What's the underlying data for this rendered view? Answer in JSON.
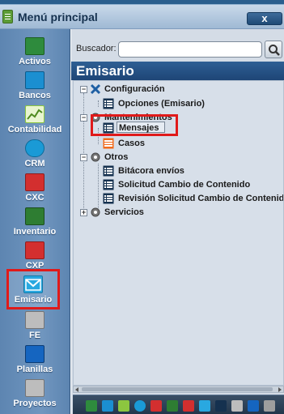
{
  "window": {
    "title": "Menú principal",
    "close_label": "x"
  },
  "sidebar": {
    "items": [
      {
        "label": "Activos",
        "icon": "ledger-icon",
        "color": "#2e8b3d"
      },
      {
        "label": "Bancos",
        "icon": "briefcase-icon",
        "color": "#1b8fd1"
      },
      {
        "label": "Contabilidad",
        "icon": "chart-icon",
        "color": "#8cc63f"
      },
      {
        "label": "CRM",
        "icon": "globe-icon",
        "color": "#1a9ad6"
      },
      {
        "label": "CXC",
        "icon": "money-icon",
        "color": "#d32f2f"
      },
      {
        "label": "Inventario",
        "icon": "worker-icon",
        "color": "#2e7d32"
      },
      {
        "label": "CXP",
        "icon": "money-out-icon",
        "color": "#d32f2f"
      },
      {
        "label": "Emisario",
        "icon": "envelope-icon",
        "color": "#29a8e0"
      },
      {
        "label": "FE",
        "icon": "tools-icon",
        "color": "#9e9e9e"
      },
      {
        "label": "Planillas",
        "icon": "stack-icon",
        "color": "#1565c0"
      },
      {
        "label": "Proyectos",
        "icon": "pencil-ruler-icon",
        "color": "#9e9e9e"
      }
    ]
  },
  "search": {
    "label": "Buscador:",
    "value": "",
    "placeholder": ""
  },
  "section": {
    "title": "Emisario"
  },
  "tree": {
    "configuracion": {
      "label": "Configuración",
      "expanded": true
    },
    "opciones": {
      "label": "Opciones (Emisario)"
    },
    "mantenimientos": {
      "label": "Mantenimientos",
      "expanded": true
    },
    "mensajes": {
      "label": "Mensajes",
      "selected": true
    },
    "casos": {
      "label": "Casos"
    },
    "otros": {
      "label": "Otros",
      "expanded": true
    },
    "bitacora": {
      "label": "Bitácora envíos"
    },
    "solicitud": {
      "label": "Solicitud Cambio de Contenido"
    },
    "revision": {
      "label": "Revisión Solicitud Cambio de Contenido"
    },
    "servicios": {
      "label": "Servicios",
      "expanded": false
    }
  },
  "colors": {
    "accent_header": "#1e4576",
    "highlight_red": "#e01a1a",
    "sidebar_bg": "#6a90ba"
  }
}
